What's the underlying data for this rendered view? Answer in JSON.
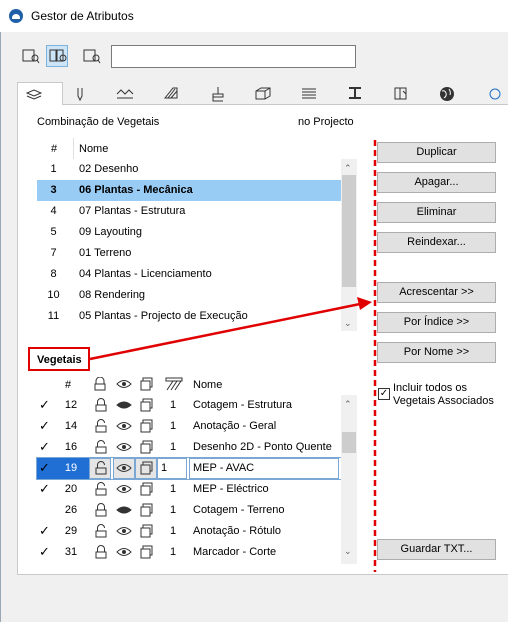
{
  "window": {
    "title": "Gestor de Atributos"
  },
  "icons": {
    "app": "archicad-icon",
    "mode1": "list-view-icon",
    "mode2": "compare-view-icon",
    "mode3": "details-view-icon"
  },
  "tabs": [
    {
      "icon": "layers-icon"
    },
    {
      "icon": "pen-icon"
    },
    {
      "icon": "line-type-icon"
    },
    {
      "icon": "fill-icon"
    },
    {
      "icon": "paint-icon"
    },
    {
      "icon": "composite-icon"
    },
    {
      "icon": "profile-icon"
    },
    {
      "icon": "zone-icon"
    },
    {
      "icon": "material-icon"
    },
    {
      "icon": "globe-icon"
    }
  ],
  "combo": {
    "title": "Combinação de Vegetais",
    "in_project": "no Projecto",
    "col_num": "#",
    "col_name": "Nome",
    "rows": [
      {
        "num": "1",
        "name": "02 Desenho"
      },
      {
        "num": "3",
        "name": "06 Plantas - Mecânica",
        "selected": true
      },
      {
        "num": "4",
        "name": "07 Plantas - Estrutura"
      },
      {
        "num": "5",
        "name": "09 Layouting"
      },
      {
        "num": "7",
        "name": "01 Terreno"
      },
      {
        "num": "8",
        "name": "04 Plantas - Licenciamento"
      },
      {
        "num": "10",
        "name": "08 Rendering"
      },
      {
        "num": "11",
        "name": "05 Plantas - Projecto de Execução"
      }
    ]
  },
  "buttons": {
    "duplicate": "Duplicar",
    "clear": "Apagar...",
    "delete": "Eliminar",
    "reindex": "Reindexar...",
    "add": "Acrescentar >>",
    "by_index": "Por Índice >>",
    "by_name": "Por Nome >>",
    "save_txt": "Guardar TXT..."
  },
  "layers": {
    "title": "Vegetais",
    "col_num": "#",
    "col_name": "Nome",
    "include_all": "Incluir todos os",
    "include_all_2": "Vegetais Associados",
    "include_checked": "✓",
    "rows": [
      {
        "check": "✓",
        "num": "12",
        "count": "1",
        "name": "Cotagem - Estrutura",
        "lock": true,
        "eye": "hidden"
      },
      {
        "check": "✓",
        "num": "14",
        "count": "1",
        "name": "Anotação - Geral",
        "lock": false,
        "eye": "open"
      },
      {
        "check": "✓",
        "num": "16",
        "count": "1",
        "name": "Desenho 2D - Ponto Quente",
        "lock": false,
        "eye": "open"
      },
      {
        "check": "✓",
        "num": "19",
        "count": "1",
        "name": "MEP - AVAC",
        "lock": false,
        "eye": "open",
        "selected": true
      },
      {
        "check": "✓",
        "num": "20",
        "count": "1",
        "name": "MEP - Eléctrico",
        "lock": false,
        "eye": "open"
      },
      {
        "check": "",
        "num": "26",
        "count": "1",
        "name": "Cotagem - Terreno",
        "lock": true,
        "eye": "hidden"
      },
      {
        "check": "✓",
        "num": "29",
        "count": "1",
        "name": "Anotação - Rótulo",
        "lock": false,
        "eye": "open"
      },
      {
        "check": "✓",
        "num": "31",
        "count": "1",
        "name": "Marcador - Corte",
        "lock": true,
        "eye": "open"
      }
    ]
  },
  "colors": {
    "selection": "#99ccf5",
    "annotation": "#e00000",
    "active_mode": "#cce4f7"
  }
}
